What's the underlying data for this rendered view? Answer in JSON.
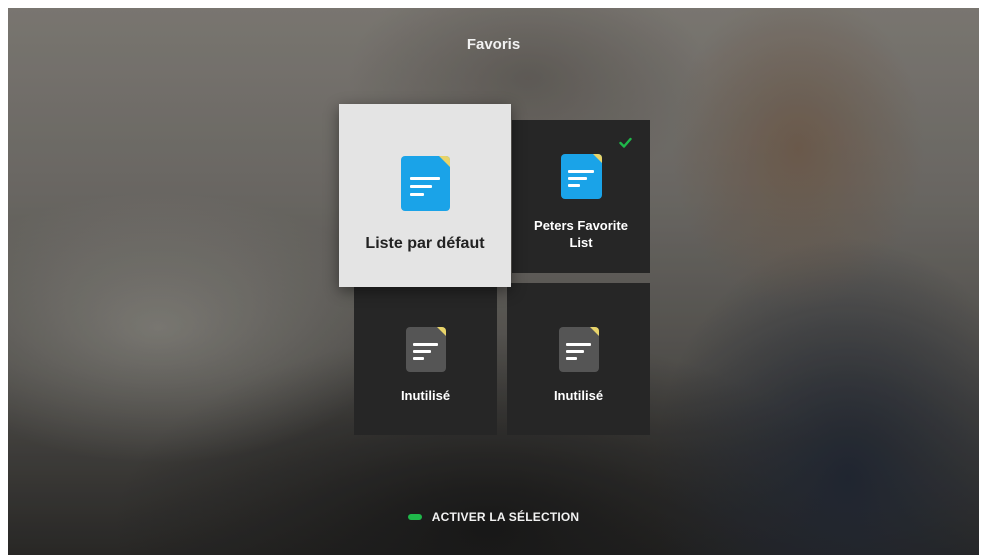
{
  "header": {
    "title": "Favoris"
  },
  "lists": [
    {
      "label": "Liste par défaut",
      "icon": "document-list-icon",
      "state": "focused",
      "active": false
    },
    {
      "label": "Peters Favorite List",
      "icon": "document-list-icon",
      "state": "normal",
      "active": true
    },
    {
      "label": "Inutilisé",
      "icon": "document-list-icon",
      "state": "unused",
      "active": false
    },
    {
      "label": "Inutilisé",
      "icon": "document-list-icon",
      "state": "unused",
      "active": false
    }
  ],
  "footer": {
    "action_label": "ACTIVER LA SÉLECTION",
    "indicator_color": "#1fb84a"
  },
  "colors": {
    "icon_blue": "#1aa3e8",
    "icon_fold_yellow": "#e8d46a",
    "icon_grey": "#555555",
    "check_green": "#1fb84a",
    "tile_dark": "#262626",
    "tile_focused": "#e4e4e4"
  }
}
